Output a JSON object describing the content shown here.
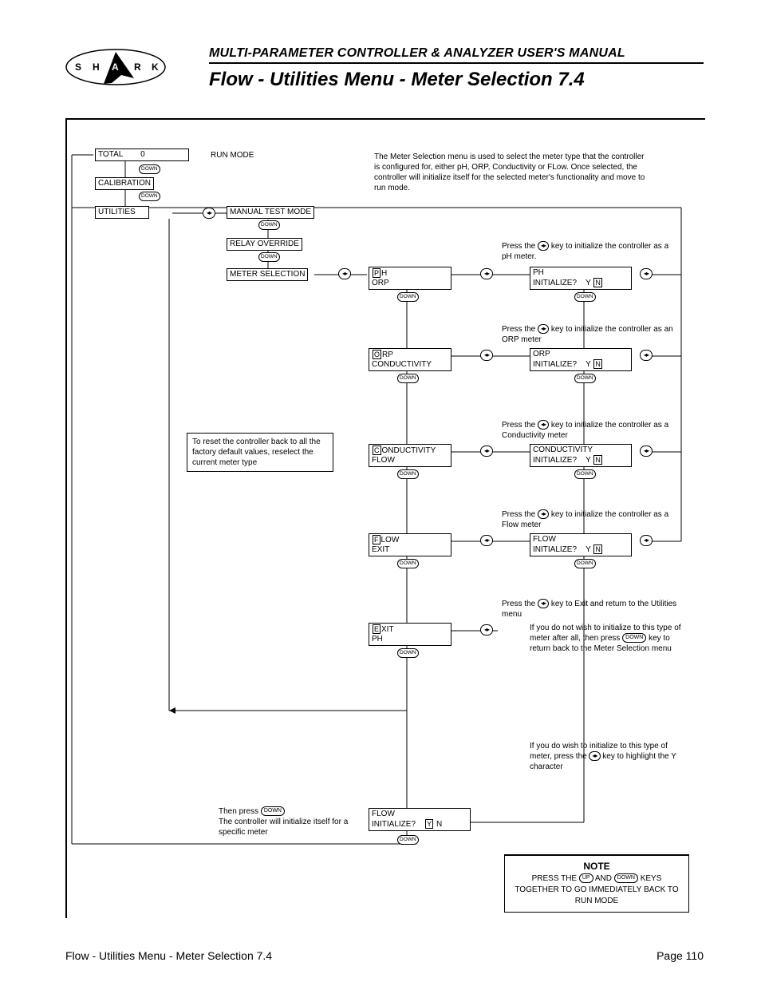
{
  "header": {
    "subtitle": "MULTI-PARAMETER CONTROLLER & ANALYZER USER'S MANUAL",
    "title": "Flow - Utilities Menu - Meter Selection 7.4"
  },
  "logo_letters": [
    "S",
    "H",
    "A",
    "R",
    "K"
  ],
  "menu": {
    "total": "TOTAL",
    "total_value": "0",
    "run_mode": "RUN MODE",
    "calibration": "CALIBRATION",
    "utilities": "UTILITIES",
    "manual_test": "MANUAL TEST MODE",
    "relay_override": "RELAY OVERRIDE",
    "meter_selection": "METER SELECTION"
  },
  "intro_text": "The Meter Selection menu is used to select the meter type that the controller is configured for, either pH, ORP, Conductivity or FLow. Once selected, the controller will initialize itself for the selected meter's functionality and move to run mode.",
  "reset_text": "To reset the controller back to all the factory default values, reselect the current meter type",
  "keys": {
    "down": "DOWN",
    "up": "UP",
    "lr": "◂▸"
  },
  "rows": [
    {
      "lines": [
        "PH",
        "ORP"
      ],
      "hint_text": "key to initialize the controller as a pH meter.",
      "init_top": "PH",
      "init_q": "INITIALIZE?",
      "yn": [
        "Y",
        "N"
      ],
      "hl": 1
    },
    {
      "lines": [
        "ORP",
        "CONDUCTIVITY"
      ],
      "hint_text": "key to initialize the controller as an ORP meter",
      "init_top": "ORP",
      "init_q": "INITIALIZE?",
      "yn": [
        "Y",
        "N"
      ],
      "hl": 1
    },
    {
      "lines": [
        "CONDUCTIVITY",
        "FLOW"
      ],
      "hint_text": "key to initialize the controller as a Conductivity meter",
      "init_top": "CONDUCTIVITY",
      "init_q": "INITIALIZE?",
      "yn": [
        "Y",
        "N"
      ],
      "hl": 1
    },
    {
      "lines": [
        "FLOW",
        "EXIT"
      ],
      "hint_text": "key to initialize the controller as a Flow meter",
      "init_top": "FLOW",
      "init_q": "INITIALIZE?",
      "yn": [
        "Y",
        "N"
      ],
      "hl": 1
    },
    {
      "lines": [
        "EXIT",
        "PH"
      ],
      "hint_text": "key to Exit and return to the Utilities menu",
      "exit_desc": "If you do not wish to initialize to this type of meter after all, then press",
      "exit_desc2": "key to return back to the Meter Selection menu"
    }
  ],
  "init_hint": "If you do wish to initialize to this type of meter, press the",
  "init_hint2": "key to highlight the Y character",
  "final": {
    "line1": "Then press",
    "line2": "The controller will initialize itself for a specific meter",
    "disp_top": "FLOW",
    "disp_q": "INITIALIZE?",
    "yn": [
      "Y",
      "N"
    ],
    "hl": 0
  },
  "note": {
    "title": "NOTE",
    "text1": "PRESS THE",
    "text2": "AND",
    "text3": "KEYS TOGETHER TO GO IMMEDIATELY BACK TO RUN MODE"
  },
  "hint_prefix": "Press the",
  "footer": {
    "left": "Flow - Utilities Menu - Meter Selection 7.4",
    "right": "Page 110"
  }
}
